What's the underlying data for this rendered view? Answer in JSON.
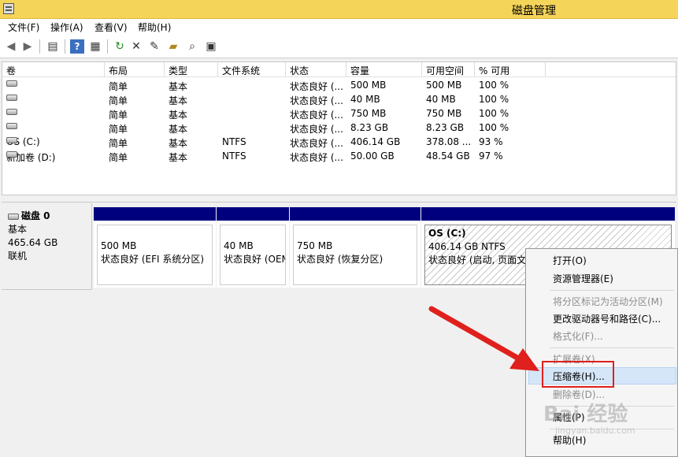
{
  "window": {
    "title": "磁盘管理"
  },
  "menu": [
    "文件(F)",
    "操作(A)",
    "查看(V)",
    "帮助(H)"
  ],
  "toolbar": [
    "back-icon",
    "forward-icon",
    "console-tree-icon",
    "help-icon",
    "properties-icon",
    "refresh-icon",
    "delete-icon",
    "settings-icon",
    "open-icon",
    "search-icon",
    "export-icon"
  ],
  "volumes": {
    "headers": [
      "卷",
      "布局",
      "类型",
      "文件系统",
      "状态",
      "容量",
      "可用空间",
      "% 可用"
    ],
    "rows": [
      [
        "",
        "简单",
        "基本",
        "",
        "状态良好 (...",
        "500 MB",
        "500 MB",
        "100 %"
      ],
      [
        "",
        "简单",
        "基本",
        "",
        "状态良好 (...",
        "40 MB",
        "40 MB",
        "100 %"
      ],
      [
        "",
        "简单",
        "基本",
        "",
        "状态良好 (...",
        "750 MB",
        "750 MB",
        "100 %"
      ],
      [
        "",
        "简单",
        "基本",
        "",
        "状态良好 (...",
        "8.23 GB",
        "8.23 GB",
        "100 %"
      ],
      [
        "OS (C:)",
        "简单",
        "基本",
        "NTFS",
        "状态良好 (...",
        "406.14 GB",
        "378.08 ...",
        "93 %"
      ],
      [
        "新加卷 (D:)",
        "简单",
        "基本",
        "NTFS",
        "状态良好 (...",
        "50.00 GB",
        "48.54 GB",
        "97 %"
      ]
    ]
  },
  "disk": {
    "name": "磁盘 0",
    "type": "基本",
    "size": "465.64 GB",
    "status": "联机"
  },
  "partitions": [
    {
      "l1": "500 MB",
      "l2": "",
      "l3": "状态良好 (EFI 系统分区)"
    },
    {
      "l1": "40 MB",
      "l2": "",
      "l3": "状态良好 (OEM"
    },
    {
      "l1": "750 MB",
      "l2": "",
      "l3": "状态良好 (恢复分区)"
    },
    {
      "l1": "OS  (C:)",
      "l2": "406.14 GB NTFS",
      "l3": "状态良好 (启动, 页面文件"
    }
  ],
  "context_menu": {
    "open": "打开(O)",
    "explorer": "资源管理器(E)",
    "mark_active": "将分区标记为活动分区(M)",
    "change_letter": "更改驱动器号和路径(C)...",
    "format": "格式化(F)...",
    "extend": "扩展卷(X)...",
    "shrink": "压缩卷(H)...",
    "delete": "删除卷(D)...",
    "properties": "属性(P)",
    "help": "帮助(H)"
  },
  "watermark": {
    "main": "Bai 经验",
    "sub": "jingyan.baidu.com"
  },
  "colors": {
    "titlebar": "#f5d45a",
    "partition_header": "#00007f",
    "highlight_box": "#e0201c",
    "arrow": "#e0201c"
  }
}
